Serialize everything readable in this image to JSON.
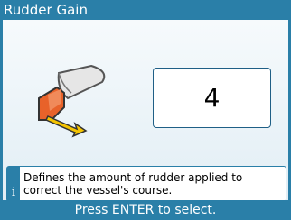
{
  "window": {
    "title": "Rudder Gain"
  },
  "setting": {
    "value": "4"
  },
  "illustration": {
    "icon": "rudder-boat-icon"
  },
  "info": {
    "icon_label": "i",
    "text": "Defines the amount of rudder applied to correct the vessel's course."
  },
  "footer": {
    "hint": "Press ENTER to select."
  },
  "colors": {
    "accent": "#2a7fa8",
    "arrow": "#f5c400",
    "rudder": "#e8622a"
  }
}
